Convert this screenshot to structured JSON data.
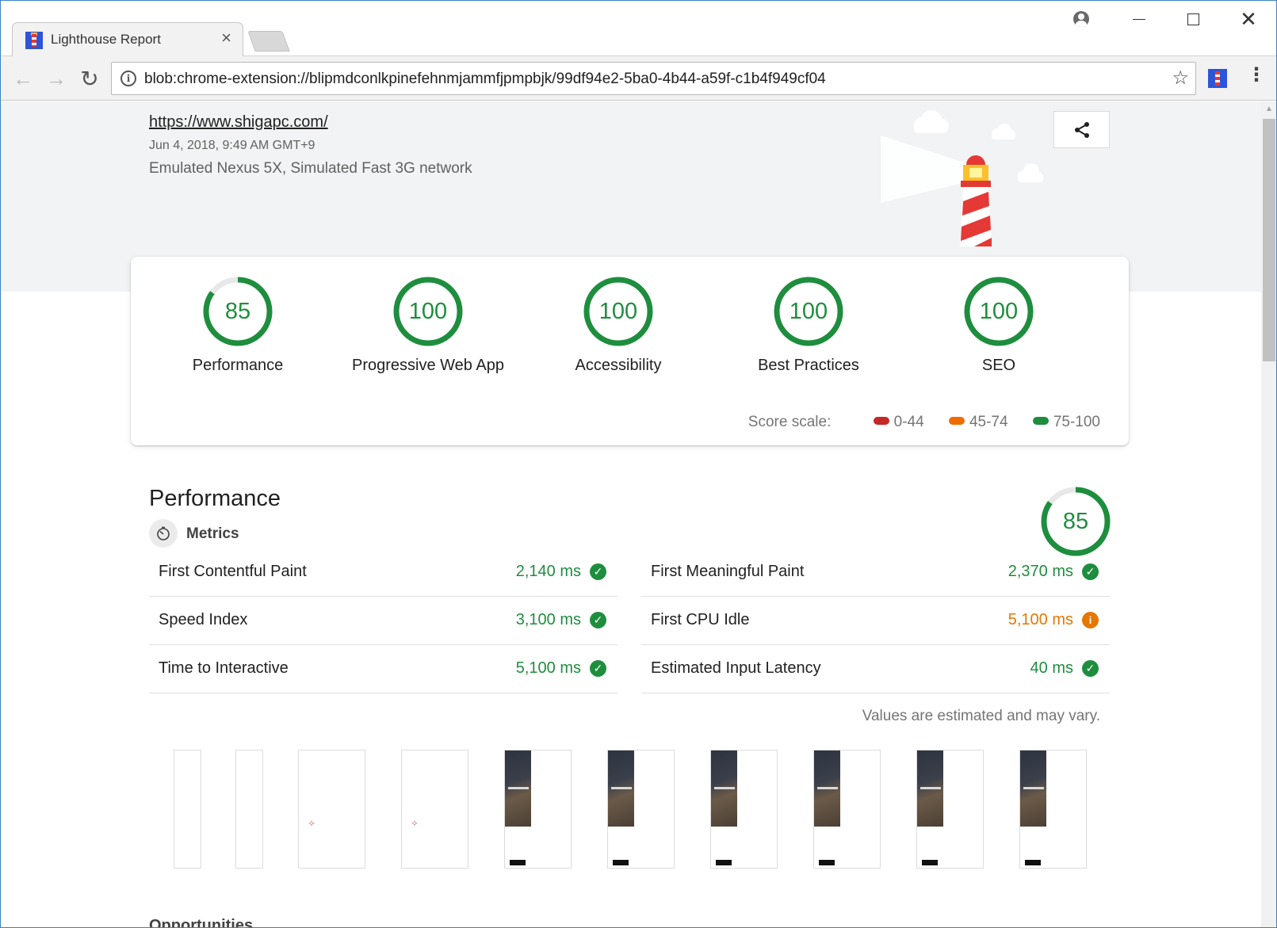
{
  "browser": {
    "tab_title": "Lighthouse Report",
    "tab_close": "×",
    "url": "blob:chrome-extension://blipmdconlkpinefehnmjammfjpmpbjk/99df94e2-5ba0-4b44-a59f-c1b4f949cf04",
    "window_close": "✕",
    "back": "←",
    "forward": "→",
    "reload": "↻",
    "star": "☆",
    "menu": "⋮",
    "info": "i"
  },
  "report": {
    "site_url": "https://www.shigapc.com/",
    "date": "Jun 4, 2018, 9:49 AM GMT+9",
    "environment": "Emulated Nexus 5X, Simulated Fast 3G network"
  },
  "categories": [
    {
      "label": "Performance",
      "score": "85",
      "value": 85
    },
    {
      "label": "Progressive Web App",
      "score": "100",
      "value": 100
    },
    {
      "label": "Accessibility",
      "score": "100",
      "value": 100
    },
    {
      "label": "Best Practices",
      "score": "100",
      "value": 100
    },
    {
      "label": "SEO",
      "score": "100",
      "value": 100
    }
  ],
  "score_scale": {
    "title": "Score scale:",
    "ranges": [
      {
        "label": "0-44",
        "color": "#c62828"
      },
      {
        "label": "45-74",
        "color": "#ef6c00"
      },
      {
        "label": "75-100",
        "color": "#1e8e3e"
      }
    ]
  },
  "performance": {
    "title": "Performance",
    "score": "85",
    "metrics_title": "Metrics",
    "metrics": [
      {
        "name": "First Contentful Paint",
        "value": "2,140 ms",
        "status": "pass"
      },
      {
        "name": "First Meaningful Paint",
        "value": "2,370 ms",
        "status": "pass"
      },
      {
        "name": "Speed Index",
        "value": "3,100 ms",
        "status": "pass"
      },
      {
        "name": "First CPU Idle",
        "value": "5,100 ms",
        "status": "average"
      },
      {
        "name": "Time to Interactive",
        "value": "5,100 ms",
        "status": "pass"
      },
      {
        "name": "Estimated Input Latency",
        "value": "40 ms",
        "status": "pass"
      }
    ],
    "note": "Values are estimated and may vary.",
    "next_section": "Opportunities"
  },
  "colors": {
    "pass": "#1e8e3e",
    "average": "#e67700",
    "gauge_track": "#e8e8e8"
  }
}
